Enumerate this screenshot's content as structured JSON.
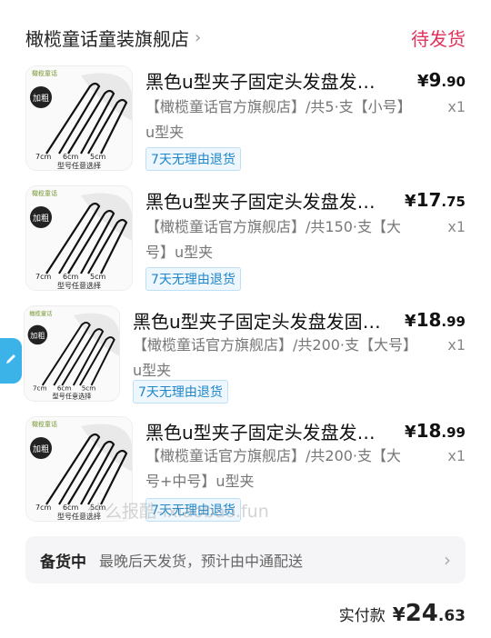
{
  "order": {
    "shop_name": "橄榄童话童装旗舰店",
    "shop_chevron": "›",
    "status": "待发货"
  },
  "items": [
    {
      "title": "黑色u型夹子固定头发盘发…",
      "spec": "【橄榄童话官方旗舰店】/共5·支【小号】u型夹",
      "price_int": "9",
      "price_dec": ".90",
      "qty": "x1",
      "tag": "7天无理由退货",
      "thumb": {
        "badge": "加粗",
        "sizes": [
          "7cm",
          "6cm",
          "5cm"
        ],
        "caption": "型号任意选择",
        "logo": "橄榄童话"
      }
    },
    {
      "title": "黑色u型夹子固定头发盘发…",
      "spec": "【橄榄童话官方旗舰店】/共150·支【大号】u型夹",
      "price_int": "17",
      "price_dec": ".75",
      "qty": "x1",
      "tag": "7天无理由退货",
      "thumb": {
        "badge": "加粗",
        "sizes": [
          "7cm",
          "6cm",
          "5cm"
        ],
        "caption": "型号任意选择",
        "logo": "橄榄童话"
      }
    },
    {
      "title": "黑色u型夹子固定头发盘发固定…",
      "spec": "【橄榄童话官方旗舰店】/共200·支【大号】u型夹",
      "price_int": "18",
      "price_dec": ".99",
      "qty": "x1",
      "tag": "7天无理由退货",
      "thumb": {
        "badge": "加粗",
        "sizes": [
          "7cm",
          "6cm",
          "5cm"
        ],
        "caption": "型号任意选择",
        "logo": "橄榄童话"
      }
    },
    {
      "title": "黑色u型夹子固定头发盘发…",
      "spec": "【橄榄童话官方旗舰店】/共200·支【大号+中号】u型夹",
      "price_int": "18",
      "price_dec": ".99",
      "qty": "x1",
      "tag": "7天无理由退货",
      "thumb": {
        "badge": "加粗",
        "sizes": [
          "7cm",
          "6cm",
          "5cm"
        ],
        "caption": "型号任意选择",
        "logo": "橄榄童话"
      }
    }
  ],
  "currency": "¥",
  "shipping": {
    "label": "备货中",
    "text": "最晚后天发货，预计由中通配送",
    "chevron": "›"
  },
  "total": {
    "label": "实付款",
    "int": "24",
    "dec": ".63"
  },
  "watermark": "什么报酷-ixiaobao.fun",
  "side_button_icon": "edit-icon",
  "colors": {
    "status": "#e0335b",
    "tag": "#1f86c9",
    "side_button": "#3cb3e8"
  }
}
